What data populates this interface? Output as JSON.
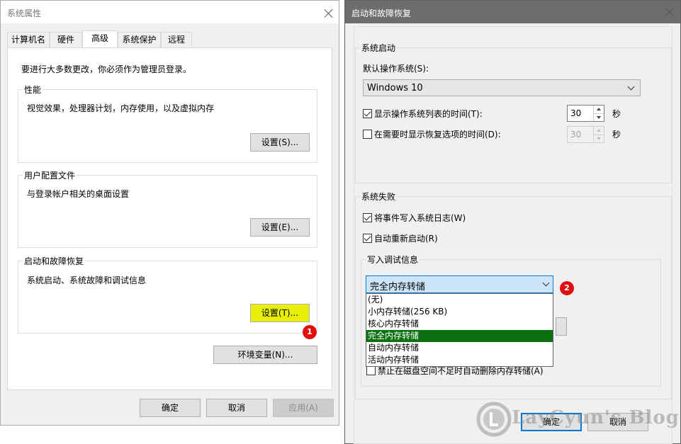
{
  "left_window": {
    "title": "系统属性",
    "tabs": [
      {
        "label": "计算机名",
        "active": false
      },
      {
        "label": "硬件",
        "active": false
      },
      {
        "label": "高级",
        "active": true
      },
      {
        "label": "系统保护",
        "active": false
      },
      {
        "label": "远程",
        "active": false
      }
    ],
    "admin_note": "要进行大多数更改，你必须作为管理员登录。",
    "performance": {
      "title": "性能",
      "desc": "视觉效果，处理器计划，内存使用，以及虚拟内存",
      "button": "设置(S)..."
    },
    "user_profiles": {
      "title": "用户配置文件",
      "desc": "与登录帐户相关的桌面设置",
      "button": "设置(E)..."
    },
    "startup_recovery": {
      "title": "启动和故障恢复",
      "desc": "系统启动、系统故障和调试信息",
      "button": "设置(T)..."
    },
    "env_button": "环境变量(N)...",
    "ok": "确定",
    "cancel": "取消",
    "apply": "应用(A)"
  },
  "right_window": {
    "title": "启动和故障恢复",
    "system_startup": {
      "title": "系统启动",
      "default_os_label": "默认操作系统(S):",
      "default_os_value": "Windows 10",
      "show_os_list": {
        "label": "显示操作系统列表的时间(T):",
        "checked": true,
        "value": "30",
        "unit": "秒"
      },
      "show_recovery": {
        "label": "在需要时显示恢复选项的时间(D):",
        "checked": false,
        "value": "30",
        "unit": "秒"
      }
    },
    "system_failure": {
      "title": "系统失败",
      "write_event_log": {
        "label": "将事件写入系统日志(W)",
        "checked": true
      },
      "auto_restart": {
        "label": "自动重新启动(R)",
        "checked": true
      },
      "debug_info": {
        "title": "写入调试信息",
        "selected": "完全内存转储",
        "options": [
          "(无)",
          "小内存转储(256 KB)",
          "核心内存转储",
          "完全内存转储",
          "自动内存转储",
          "活动内存转储"
        ],
        "selected_index": 3
      },
      "disable_overwrite": {
        "label": "禁止在磁盘空间不足时自动删除内存转储(A)",
        "checked": false
      }
    },
    "ok": "确定",
    "cancel": "取消"
  },
  "annotations": {
    "badge1": "1",
    "badge2": "2"
  },
  "watermark": "LayCyun's Blog",
  "colors": {
    "highlight_button": "#e8f00a",
    "selected_item": "#0a7010",
    "badge": "#e01010",
    "focus_border": "#0078d7"
  }
}
